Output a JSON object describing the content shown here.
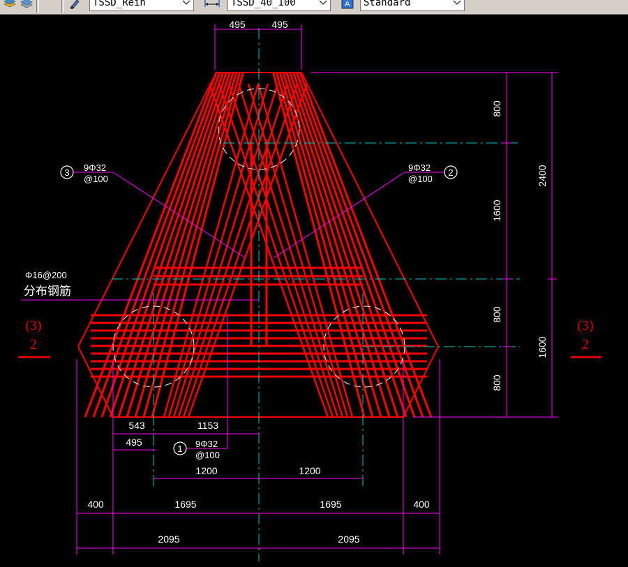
{
  "toolbar": {
    "layer_combo": "TSSD_Rein",
    "dimstyle_combo": "TSSD_40_100",
    "textstyle_combo": "Standard",
    "icons": [
      "layer-icon",
      "layer-states-icon",
      "brush-icon",
      "dimstyle-icon",
      "textstyle-icon"
    ]
  },
  "drawing": {
    "top_dims": [
      "495",
      "495"
    ],
    "right_dims_inner": [
      "800",
      "1600",
      "800",
      "800"
    ],
    "right_dims_outer": [
      "2400",
      "1600"
    ],
    "bottom_dims_row1": [
      "543",
      "1153"
    ],
    "bottom_dims_row2": [
      "495"
    ],
    "bottom_dims_row3": [
      "1200",
      "1200"
    ],
    "bottom_dims_row4": [
      "400",
      "1695",
      "1695",
      "400"
    ],
    "bottom_dims_row5": [
      "2095",
      "2095"
    ],
    "callout_1": {
      "num": "1",
      "line1": "9Φ32",
      "line2": "@100"
    },
    "callout_2": {
      "num": "2",
      "line1": "9Φ32",
      "line2": "@100"
    },
    "callout_3": {
      "num": "3",
      "line1": "9Φ32",
      "line2": "@100"
    },
    "distribution_label": {
      "line1": "Φ16@200",
      "line2": "分布钢筋"
    },
    "section_left": {
      "top": "(3)",
      "bottom": "2"
    },
    "section_right": {
      "top": "(3)",
      "bottom": "2"
    }
  },
  "colors": {
    "background": "#000000",
    "rebar": "#ff0000",
    "dimension": "#ff00ff",
    "centerline": "#00c8c8",
    "text": "#ffffff"
  }
}
